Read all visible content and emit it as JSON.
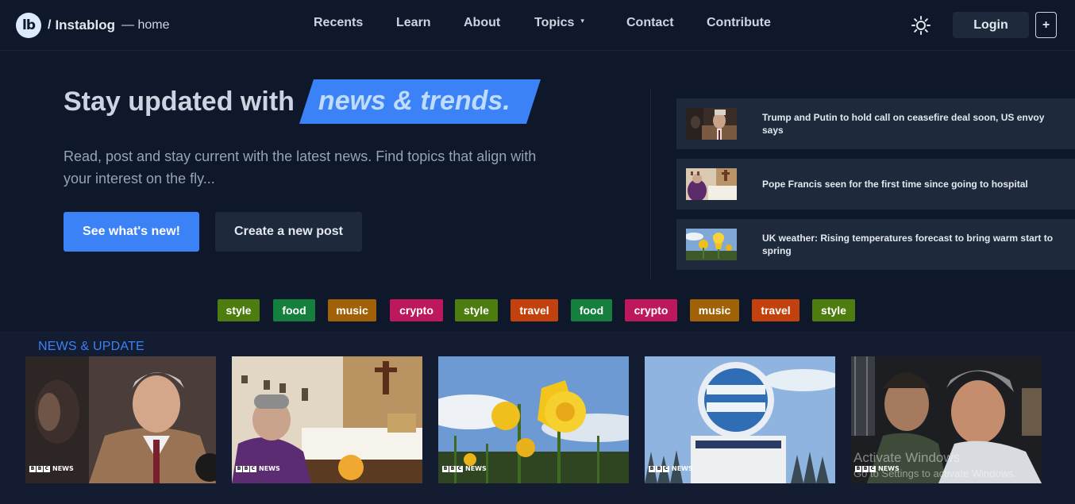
{
  "brand": {
    "logo_text": "lb",
    "slash": "/",
    "name": "Instablog",
    "page": "— home"
  },
  "nav": {
    "items": [
      "Recents",
      "Learn",
      "About",
      "Topics",
      "Contact",
      "Contribute"
    ],
    "topics_caret": "▾"
  },
  "header": {
    "theme_icon": "sun-icon",
    "login_label": "Login",
    "plus_label": "+"
  },
  "hero": {
    "title_plain": "Stay updated with",
    "title_accent": "news & trends.",
    "description": "Read, post and stay current with the latest news. Find topics that align with your interest on the fly...",
    "primary_button": "See what's new!",
    "secondary_button": "Create a new post"
  },
  "latest_news": [
    {
      "title": "Trump and Putin to hold call on ceasefire deal soon, US envoy says"
    },
    {
      "title": "Pope Francis seen for the first time since going to hospital"
    },
    {
      "title": "UK weather: Rising temperatures forecast to bring warm start to spring"
    }
  ],
  "tags": [
    {
      "label": "style",
      "color": "#4d7c0f"
    },
    {
      "label": "food",
      "color": "#15803d"
    },
    {
      "label": "music",
      "color": "#a16207"
    },
    {
      "label": "crypto",
      "color": "#be185d"
    },
    {
      "label": "style",
      "color": "#4d7c0f"
    },
    {
      "label": "travel",
      "color": "#c2410c"
    },
    {
      "label": "food",
      "color": "#15803d"
    },
    {
      "label": "crypto",
      "color": "#be185d"
    },
    {
      "label": "music",
      "color": "#a16207"
    },
    {
      "label": "travel",
      "color": "#c2410c"
    },
    {
      "label": "style",
      "color": "#4d7c0f"
    }
  ],
  "news_section": {
    "title": "NEWS & UPDATE",
    "badge_letters": [
      "B",
      "B",
      "C"
    ],
    "badge_word": "NEWS"
  },
  "colors": {
    "background": "#0f172a",
    "surface": "#1e293b",
    "accent": "#3b82f6"
  },
  "watermark": {
    "line1": "Activate Windows",
    "line2": "Go to Settings to activate Windows."
  }
}
